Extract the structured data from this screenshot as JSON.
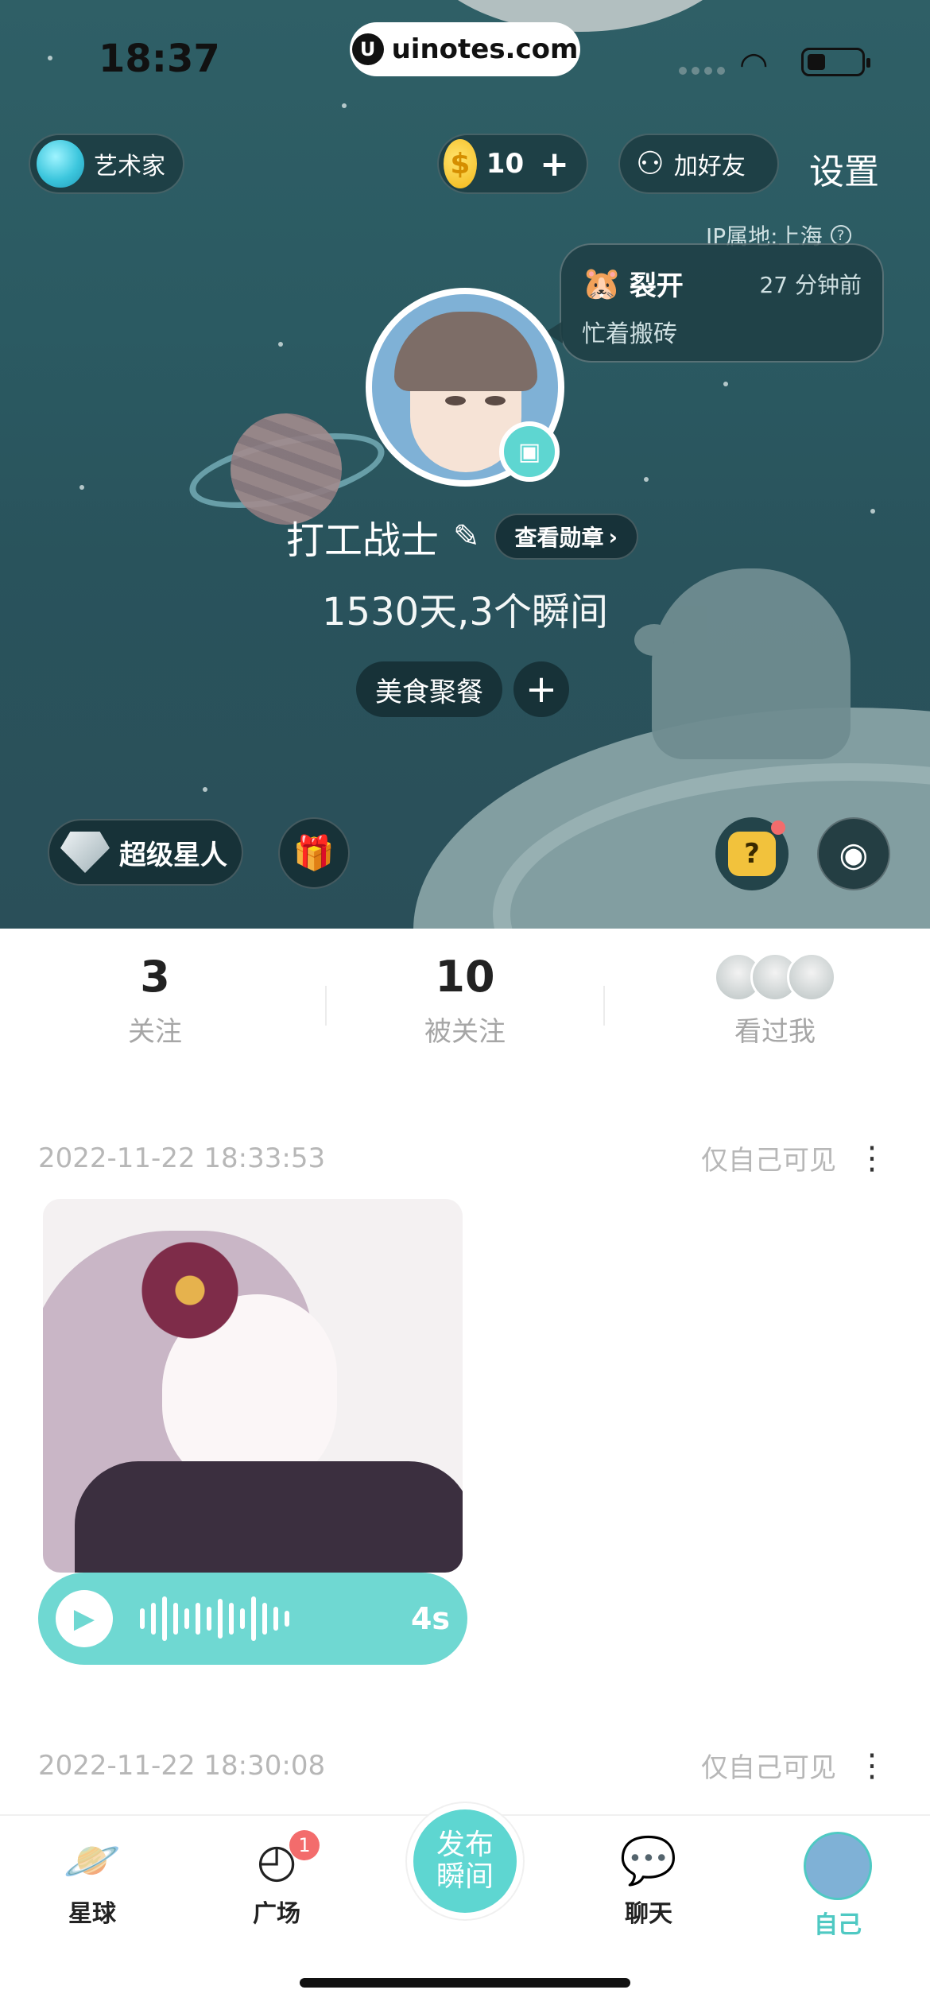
{
  "status_bar": {
    "time": "18:37",
    "site": "uinotes.com",
    "site_logo": "U"
  },
  "header": {
    "artist_label": "艺术家",
    "coins": "10",
    "coin_symbol": "$",
    "add_friend": "加好友",
    "settings": "设置",
    "ip_location": "IP属地:上海",
    "help": "?"
  },
  "status_bubble": {
    "status": "裂开",
    "time_ago": "27 分钟前",
    "note": "忙着搬砖"
  },
  "profile": {
    "name": "打工战士",
    "medals_button": "查看勋章",
    "days_summary": "1530天,3个瞬间",
    "tag": "美食聚餐",
    "super_star": "超级星人",
    "mystery_mark": "?"
  },
  "stats": [
    {
      "value": "3",
      "label": "关注"
    },
    {
      "value": "10",
      "label": "被关注"
    },
    {
      "value": "",
      "label": "看过我"
    }
  ],
  "posts": [
    {
      "datetime": "2022-11-22 18:33:53",
      "visibility": "仅自己可见",
      "voice_duration": "4s"
    },
    {
      "datetime": "2022-11-22 18:30:08",
      "visibility": "仅自己可见"
    }
  ],
  "tabbar": {
    "tabs": [
      {
        "label": "星球",
        "icon": "planet-icon"
      },
      {
        "label": "广场",
        "icon": "square-icon",
        "badge": "1"
      },
      {
        "label": "聊天",
        "icon": "chat-icon"
      },
      {
        "label": "自己",
        "icon": "avatar",
        "active": true
      }
    ],
    "publish_line1": "发布",
    "publish_line2": "瞬间"
  },
  "colors": {
    "accent": "#5ed6d1",
    "hero_bg": "#2f5f66",
    "badge_red": "#f36c6c",
    "coin_gold": "#f3b81a"
  }
}
